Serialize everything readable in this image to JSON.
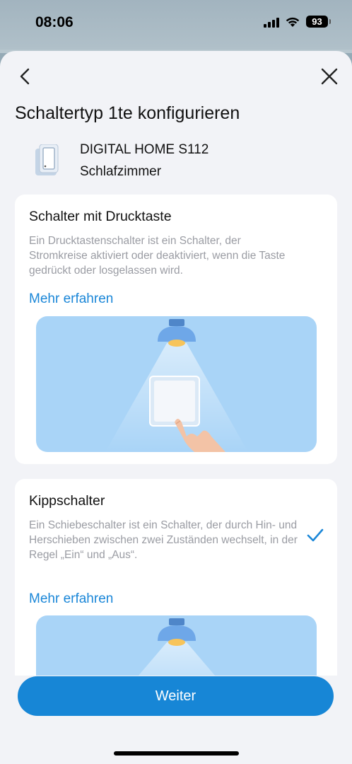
{
  "status_bar": {
    "time": "08:06",
    "battery": "93",
    "icons": [
      "signal-icon",
      "wifi-icon",
      "battery-icon"
    ]
  },
  "nav": {
    "back_icon": "chevron-left-icon",
    "close_icon": "close-icon"
  },
  "title": "Schaltertyp 1te konfigurieren",
  "device": {
    "name": "DIGITAL HOME S112",
    "room": "Schlafzimmer",
    "icon": "switch-device-icon"
  },
  "options": [
    {
      "title": "Schalter mit Drucktaste",
      "description": "Ein Drucktastenschalter ist ein Schalter, der Stromkreise aktiviert oder deaktiviert, wenn die Taste gedrückt oder losgelassen wird.",
      "link": "Mehr erfahren",
      "selected": false,
      "illustration": "push-button-switch-illustration"
    },
    {
      "title": "Kippschalter",
      "description": "Ein Schiebeschalter ist ein Schalter, der durch Hin- und Herschieben zwischen zwei Zuständen wechselt, in der Regel „Ein“ und „Aus“.",
      "link": "Mehr erfahren",
      "selected": true,
      "illustration": "toggle-switch-illustration"
    }
  ],
  "next_button": "Weiter",
  "colors": {
    "accent": "#1786d6",
    "link": "#1b87d8",
    "illustration_bg": "#a9d4f7",
    "sheet_bg": "#f2f3f7"
  }
}
